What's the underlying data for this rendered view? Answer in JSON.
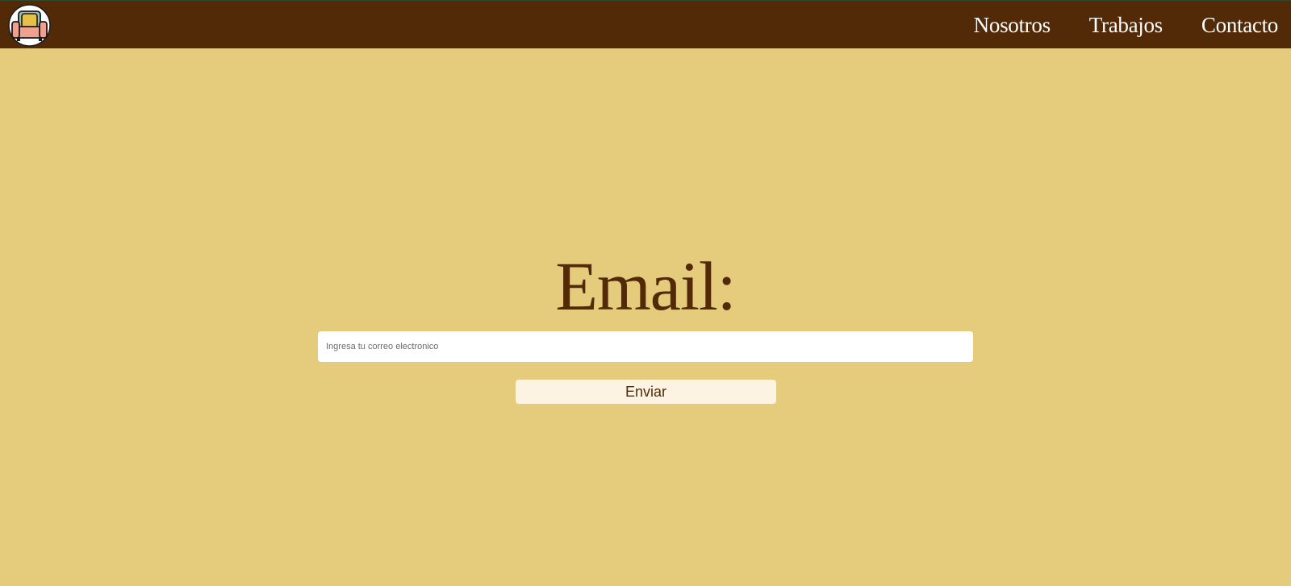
{
  "header": {
    "logo_icon": "armchair-logo-icon",
    "nav_items": [
      {
        "label": "Nosotros"
      },
      {
        "label": "Trabajos"
      },
      {
        "label": "Contacto"
      }
    ]
  },
  "main": {
    "heading": "Email:",
    "email_input": {
      "value": "",
      "placeholder": "Ingresa tu correo electronico"
    },
    "submit_label": "Enviar"
  },
  "colors": {
    "header_bg": "#522a08",
    "page_bg": "#e5cb7c",
    "heading_text": "#522a08",
    "button_bg": "#fdf3e3",
    "nav_text": "#ffffff"
  }
}
